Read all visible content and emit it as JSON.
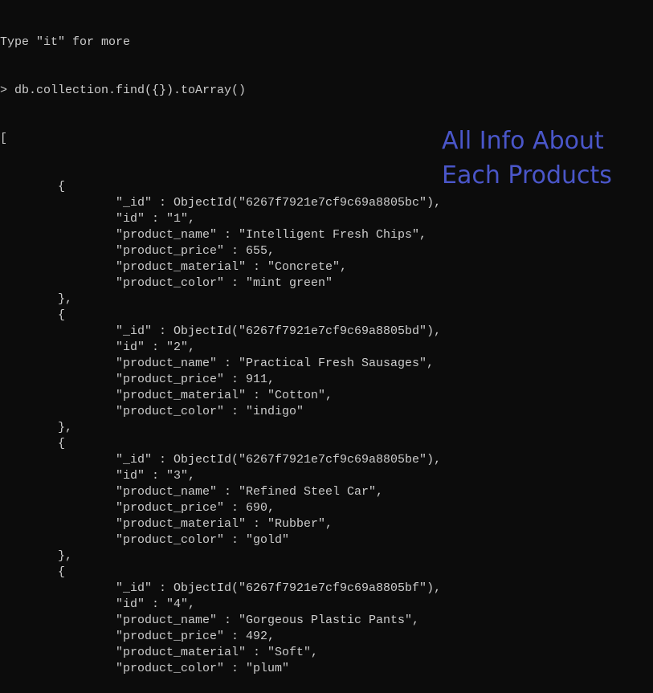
{
  "terminal": {
    "hint": "Type \"it\" for more",
    "command": "> db.collection.find({}).toArray()",
    "open_bracket": "[",
    "documents": [
      {
        "_id": "6267f7921e7cf9c69a8805bc",
        "id": "1",
        "product_name": "Intelligent Fresh Chips",
        "product_price": 655,
        "product_material": "Concrete",
        "product_color": "mint green"
      },
      {
        "_id": "6267f7921e7cf9c69a8805bd",
        "id": "2",
        "product_name": "Practical Fresh Sausages",
        "product_price": 911,
        "product_material": "Cotton",
        "product_color": "indigo"
      },
      {
        "_id": "6267f7921e7cf9c69a8805be",
        "id": "3",
        "product_name": "Refined Steel Car",
        "product_price": 690,
        "product_material": "Rubber",
        "product_color": "gold"
      },
      {
        "_id": "6267f7921e7cf9c69a8805bf",
        "id": "4",
        "product_name": "Gorgeous Plastic Pants",
        "product_price": 492,
        "product_material": "Soft",
        "product_color": "plum"
      }
    ]
  },
  "annotation": {
    "line1": "All Info About",
    "line2": "Each Products",
    "color": "#4a56c9"
  }
}
